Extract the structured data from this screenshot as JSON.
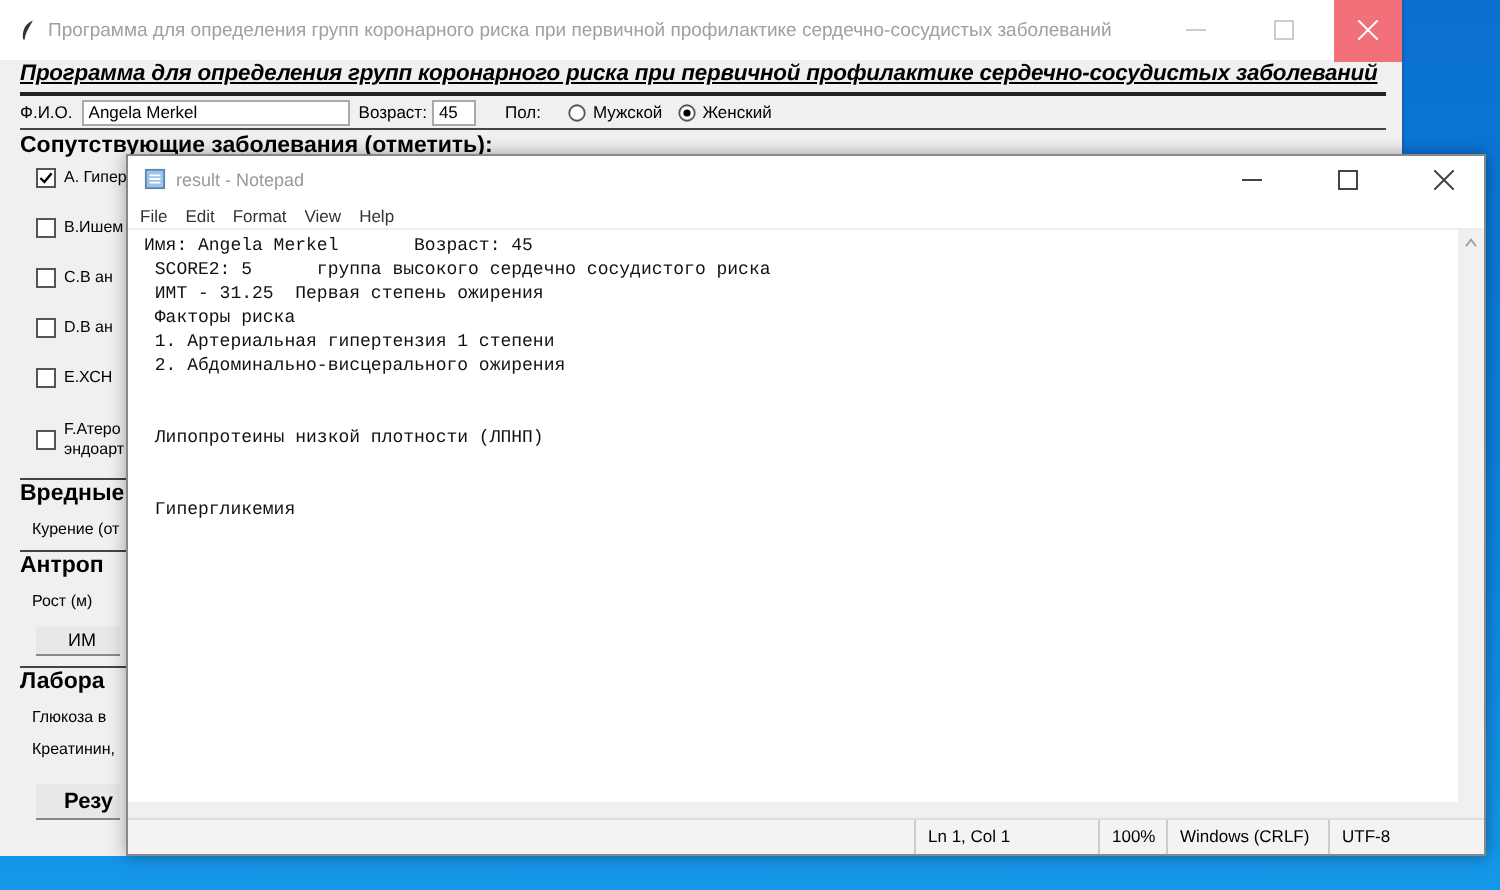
{
  "main_window": {
    "title": "Программа для определения групп коронарного риска при первичной профилактике сердечно-сосудистых заболеваний",
    "heading": "Программа для определения групп коронарного риска при первичной профилактике сердечно-сосудистых заболеваний",
    "name_label": "Ф.И.О.",
    "name_value": "Angela Merkel",
    "age_label": "Возраст:",
    "age_value": "45",
    "sex_label": "Пол:",
    "sex_options": [
      {
        "label": "Мужской",
        "selected": false
      },
      {
        "label": "Женский",
        "selected": true
      }
    ],
    "comorbidities_title": "Сопутствующие заболевания (отметить):",
    "comorbidities": [
      {
        "label": "A. Гипер",
        "checked": true
      },
      {
        "label": "B.Ишем",
        "checked": false
      },
      {
        "label": "C.В ан",
        "checked": false
      },
      {
        "label": "D.В ан",
        "checked": false
      },
      {
        "label": "E.ХСН",
        "checked": false
      },
      {
        "label": "F.Атеро\nэндоарт",
        "checked": false
      }
    ],
    "sections": [
      {
        "kind": "heading",
        "text": "Вредные"
      },
      {
        "kind": "label",
        "text": "Курение (от"
      },
      {
        "kind": "heading",
        "text": "Антроп"
      },
      {
        "kind": "label",
        "text": "Рост (м)"
      },
      {
        "kind": "button",
        "text": "ИМ"
      },
      {
        "kind": "heading",
        "text": "Лабора"
      },
      {
        "kind": "label",
        "text": "Глюкоза в"
      },
      {
        "kind": "label",
        "text": "Креатинин,"
      },
      {
        "kind": "button",
        "text": "Резу"
      }
    ]
  },
  "notepad": {
    "title": "result - Notepad",
    "menu": [
      "File",
      "Edit",
      "Format",
      "View",
      "Help"
    ],
    "content": "Имя: Angela Merkel       Возраст: 45\n SCORE2: 5      группа высокого сердечно сосудистого риска\n ИМТ - 31.25  Первая степень ожирения\n Факторы риска\n 1. Артериальная гипертензия 1 степени\n 2. Абдоминально-висцерального ожирения\n\n\n Липопротеины низкой плотности (ЛПНП)\n\n\n Гипергликемия",
    "status": [
      "Ln 1, Col 1",
      "100%",
      "Windows (CRLF)",
      "UTF-8"
    ]
  }
}
